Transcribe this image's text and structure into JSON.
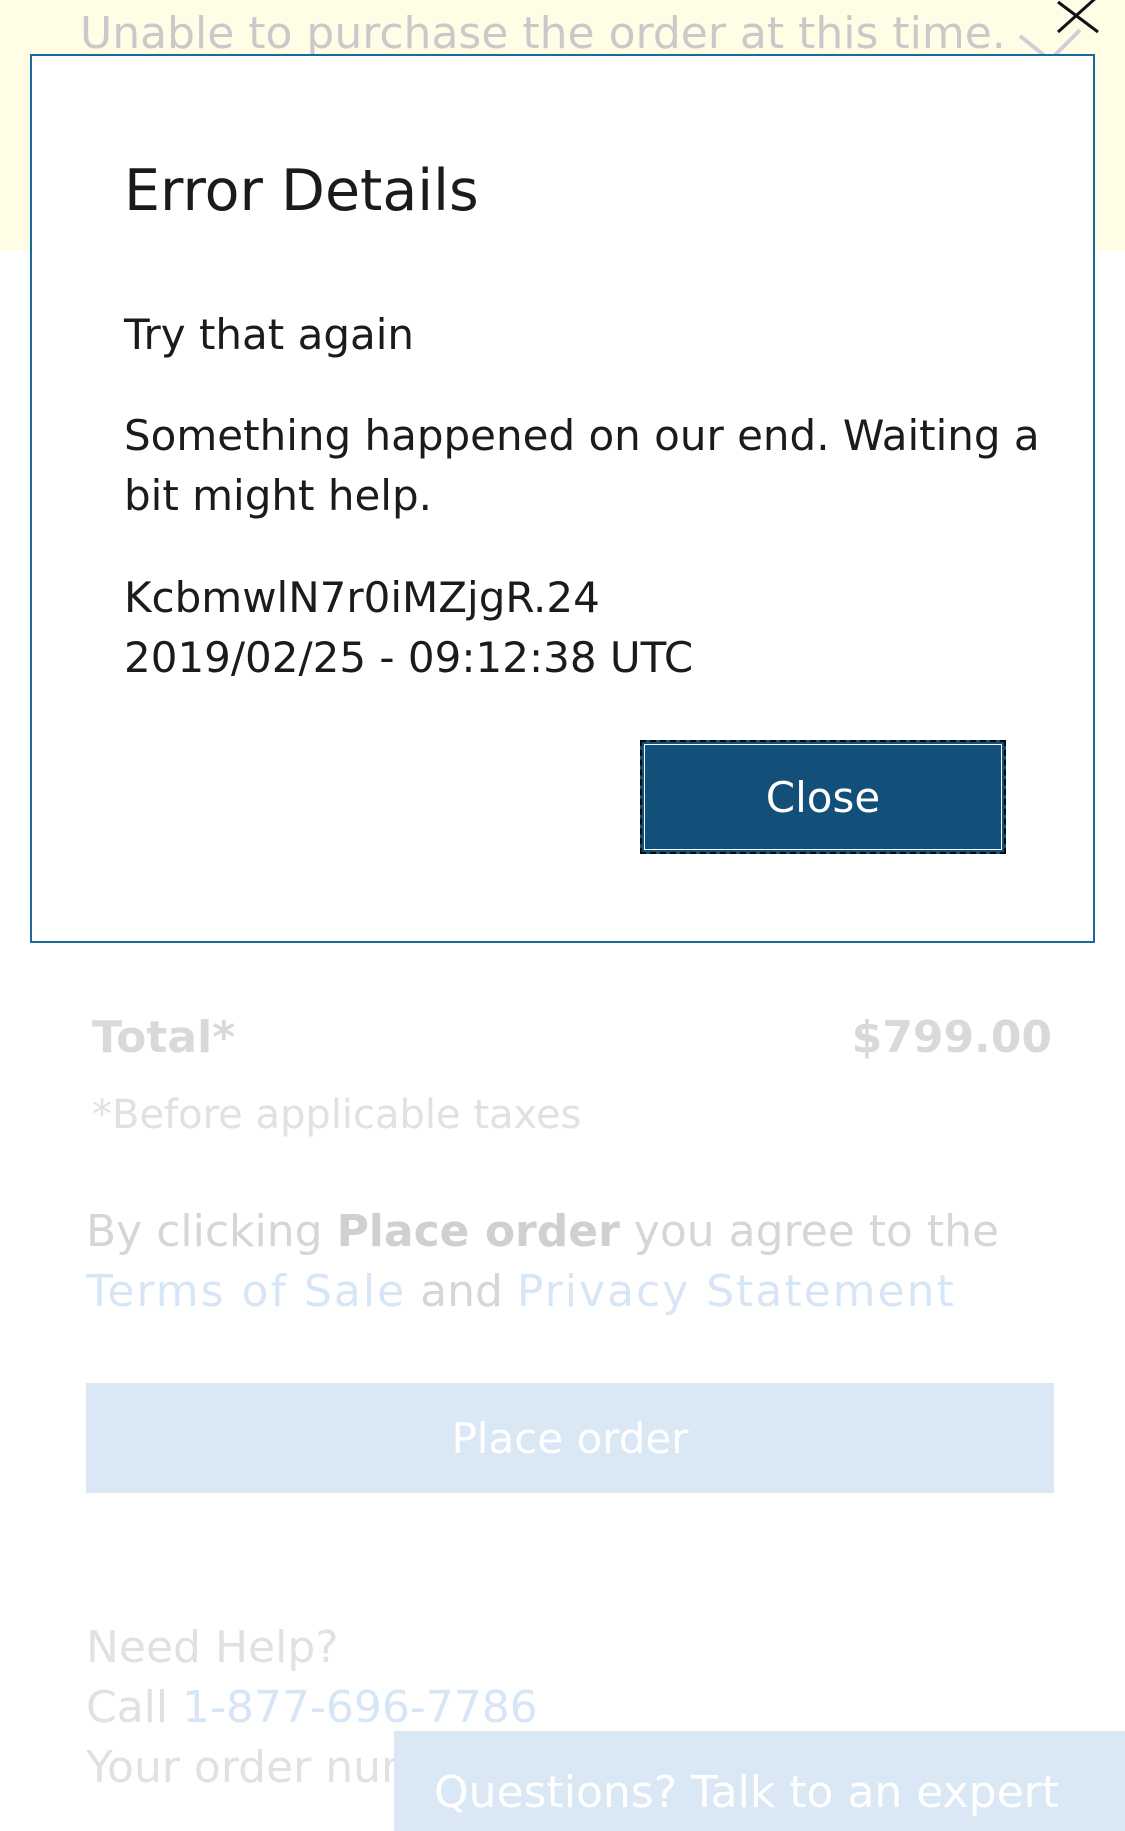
{
  "banner": {
    "message": "Unable to purchase the order at this time.",
    "icon": "close-icon"
  },
  "dialog": {
    "title": "Error Details",
    "subtitle": "Try that again",
    "message": "Something happened on our end. Waiting a bit might help.",
    "error_code": "KcbmwlN7r0iMZjgR.24",
    "timestamp": "2019/02/25 - 09:12:38 UTC",
    "close_label": "Close"
  },
  "order": {
    "total_label": "Total*",
    "total_value": "$799.00",
    "tax_note": "*Before applicable taxes",
    "agree_prefix": "By clicking ",
    "agree_bold": "Place order",
    "agree_middle": " you agree to the ",
    "terms_link": "Terms of Sale",
    "agree_and": " and ",
    "privacy_link": "Privacy Statement",
    "place_order_label": "Place order"
  },
  "help": {
    "heading": "Need Help?",
    "call_label": "Call ",
    "phone": "1-877-696-7786",
    "order_number_label": "Your order num"
  },
  "chat": {
    "label": "Questions? Talk to an expert"
  },
  "colors": {
    "dialog_border": "#1a6a99",
    "close_button": "#12507a",
    "banner_background": "#fffde6",
    "place_order_dimmed": "#dae7f5"
  }
}
